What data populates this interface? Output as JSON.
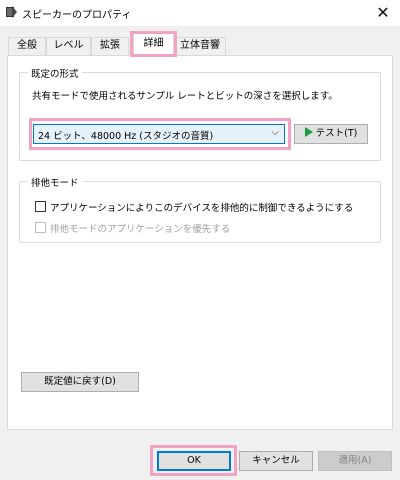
{
  "window": {
    "title": "スピーカーのプロパティ",
    "close_glyph": "✕"
  },
  "tabs": [
    {
      "label": "全般"
    },
    {
      "label": "レベル"
    },
    {
      "label": "拡張"
    },
    {
      "label": "詳細"
    },
    {
      "label": "立体音響"
    }
  ],
  "active_tab": "詳細",
  "default_format": {
    "title": "既定の形式",
    "description": "共有モードで使用されるサンプル レートとビットの深さを選択します。",
    "selected": "24 ビット、48000 Hz (スタジオの音質)",
    "test_label": "テスト(T)"
  },
  "exclusive_mode": {
    "title": "排他モード",
    "allow_exclusive": {
      "label": "アプリケーションによりこのデバイスを排他的に制御できるようにする",
      "checked": false
    },
    "priority": {
      "label": "排他モードのアプリケーションを優先する",
      "checked": false,
      "enabled": false
    }
  },
  "restore_defaults_label": "既定値に戻す(D)",
  "buttons": {
    "ok": "OK",
    "cancel": "キャンセル",
    "apply": "適用(A)"
  },
  "colors": {
    "highlight": "#f2a2c2",
    "accent": "#0078d7",
    "play": "#1f9c3f"
  }
}
